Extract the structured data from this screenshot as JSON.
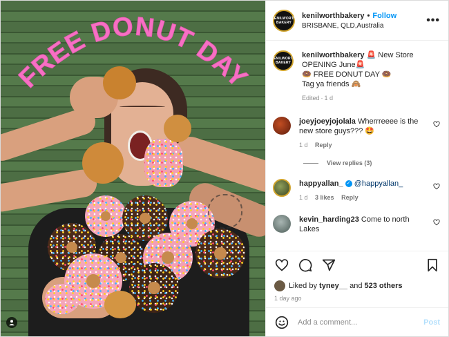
{
  "photo": {
    "headline": "FREE DONUT DAY"
  },
  "header": {
    "username": "kenilworthbakery",
    "separator": "•",
    "follow_label": "Follow",
    "location": "BRISBANE, QLD,Australia",
    "more_label": "•••"
  },
  "logo": {
    "text": "KENILWORTH BAKERY"
  },
  "caption": {
    "username": "kenilworthbakery",
    "line1": "🚨 New Store OPENING June🚨",
    "line2": "🍩 FREE DONUT DAY 🍩",
    "line3": "Tag ya friends 🙈",
    "edited": "Edited",
    "sep": "·",
    "time": "1 d"
  },
  "comments": [
    {
      "username": "joeyjoeyjojolala",
      "text": "Wherrreeee is the new store guys??? 🤩",
      "time": "1 d",
      "reply_label": "Reply",
      "view_replies": "View replies (3)",
      "avatar_color": "#a43a1c"
    },
    {
      "username": "happyallan_",
      "verified_mark": "✓",
      "mention": "@happyallan_",
      "time": "1 d",
      "likes": "3 likes",
      "reply_label": "Reply",
      "avatar_color": "#5b6b3a"
    },
    {
      "username": "kevin_harding23",
      "text": "Come to north Lakes",
      "avatar_color": "#7b8f8a"
    }
  ],
  "likes": {
    "prefix": "Liked by",
    "user": "tyney__",
    "conj": "and",
    "count": "523 others"
  },
  "time_ago": "1 day ago",
  "add_comment": {
    "placeholder": "Add a comment...",
    "post_label": "Post"
  },
  "colors": {
    "accent": "#0095f6",
    "headline_pink": "#f76fc4",
    "wall_green": "#4d6e44"
  }
}
